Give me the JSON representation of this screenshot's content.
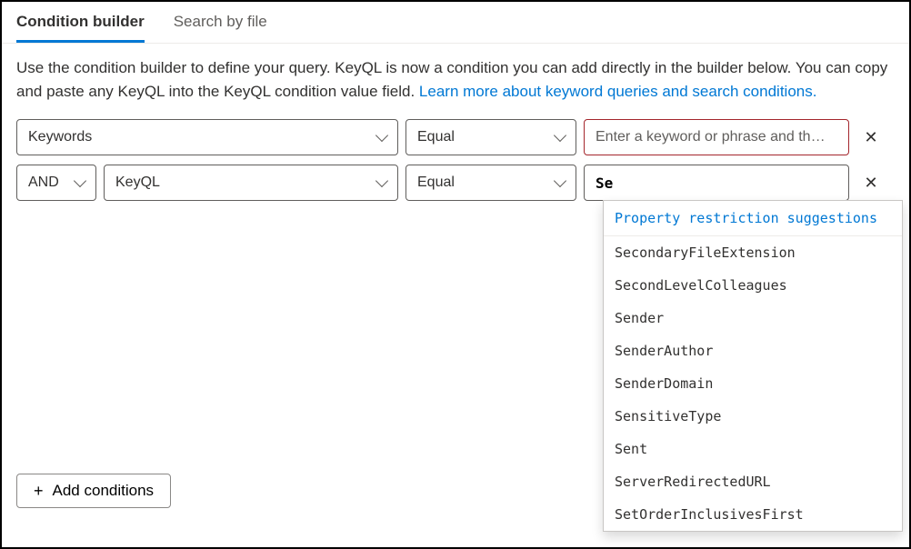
{
  "tabs": {
    "condition_builder": "Condition builder",
    "search_by_file": "Search by file"
  },
  "description": {
    "text_before_link": "Use the condition builder to define your query. KeyQL is now a condition you can add directly in the builder below. You can copy and paste any KeyQL into the KeyQL condition value field. ",
    "link_text": "Learn more about keyword queries and search conditions."
  },
  "row1": {
    "property": "Keywords",
    "operator": "Equal",
    "value_placeholder": "Enter a keyword or phrase and th…"
  },
  "row2": {
    "logical": "AND",
    "property": "KeyQL",
    "operator": "Equal",
    "value": "Se"
  },
  "suggestions": {
    "header": "Property restriction suggestions",
    "items": [
      "SecondaryFileExtension",
      "SecondLevelColleagues",
      "Sender",
      "SenderAuthor",
      "SenderDomain",
      "SensitiveType",
      "Sent",
      "ServerRedirectedURL",
      "SetOrderInclusivesFirst"
    ]
  },
  "add_button": "Add conditions"
}
